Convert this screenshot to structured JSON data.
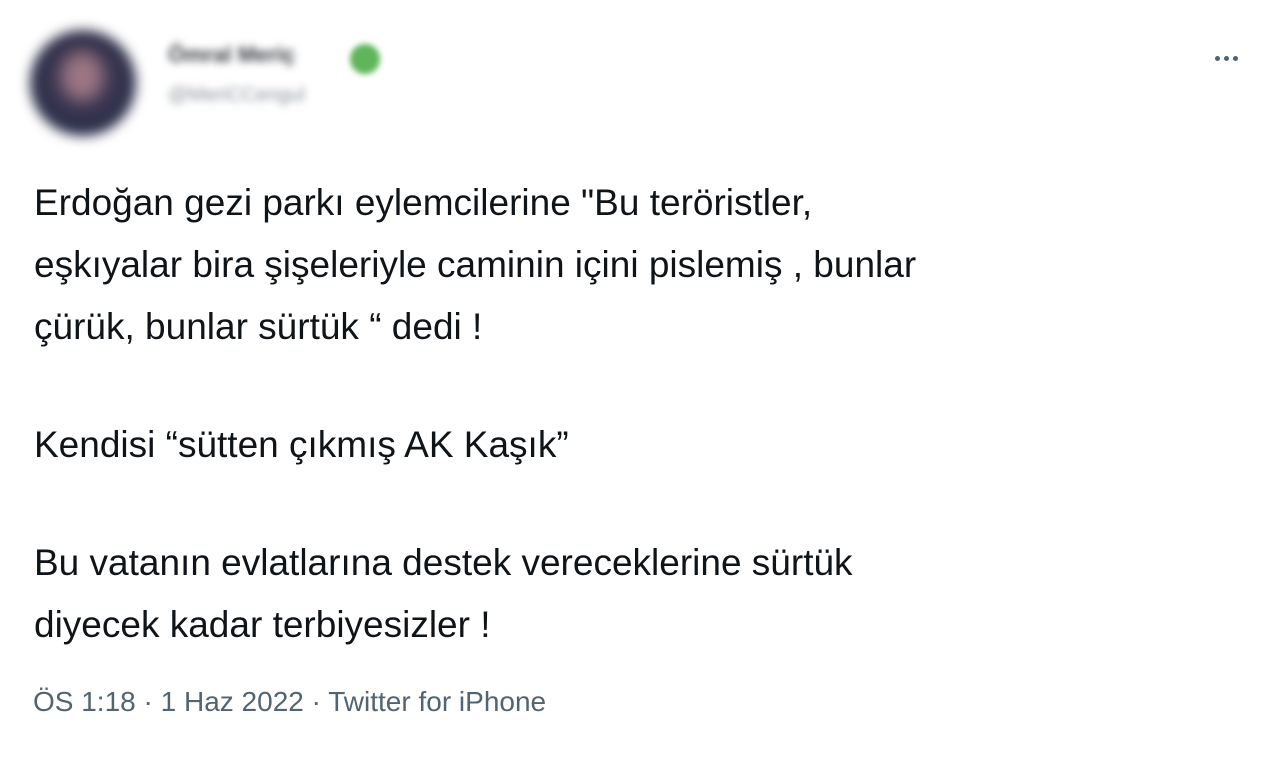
{
  "author": {
    "display_name": "Ömral Meriç",
    "handle": "@MeriCCengul",
    "verified_color": "#5fb55a"
  },
  "menu": {
    "more_icon": "more-horizontal-icon"
  },
  "tweet": {
    "lines": [
      "Erdoğan gezi parkı eylemcilerine \"Bu teröristler,",
      "eşkıyalar bira şişeleriyle caminin içini pislemiş , bunlar",
      "çürük, bunlar sürtük “ dedi !",
      "Kendisi “sütten çıkmış AK Kaşık”",
      "Bu vatanın evlatlarına destek vereceklerine sürtük",
      "diyecek kadar terbiyesizler !"
    ]
  },
  "meta": {
    "time": "ÖS 1:18",
    "separator": " · ",
    "date": "1 Haz 2022",
    "source": "Twitter for iPhone"
  }
}
